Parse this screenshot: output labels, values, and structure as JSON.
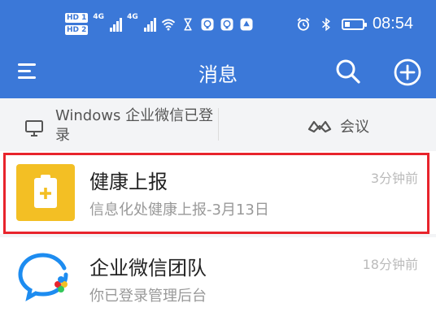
{
  "status_bar": {
    "hd_badges": [
      "HD 1",
      "HD 2"
    ],
    "network_labels": [
      "4G",
      "4G"
    ],
    "time": "08:54",
    "icons": [
      "wifi-icon",
      "hourglass-icon",
      "app-notification-icon",
      "app-notification-icon",
      "app-notification-icon",
      "alarm-icon",
      "bluetooth-icon",
      "battery-icon"
    ],
    "battery_level": 0.3
  },
  "header": {
    "title": "消息",
    "left_icon": "menu-icon",
    "right_icons": [
      "search-icon",
      "add-icon"
    ],
    "bg_color": "#3b78d8"
  },
  "subbar": {
    "pc_status": "Windows 企业微信已登录",
    "pc_icon": "monitor-icon",
    "meeting_label": "会议",
    "meeting_icon": "meeting-icon"
  },
  "chats": [
    {
      "title": "健康上报",
      "subtitle": "信息化处健康上报-3月13日",
      "time": "3分钟前",
      "avatar_icon": "clipboard-plus-icon",
      "avatar_color": "#f3bf24",
      "highlighted": true
    },
    {
      "title": "企业微信团队",
      "subtitle": "你已登录管理后台",
      "time": "18分钟前",
      "avatar_icon": "wecom-logo-icon"
    }
  ],
  "highlight_color": "#e8242c"
}
